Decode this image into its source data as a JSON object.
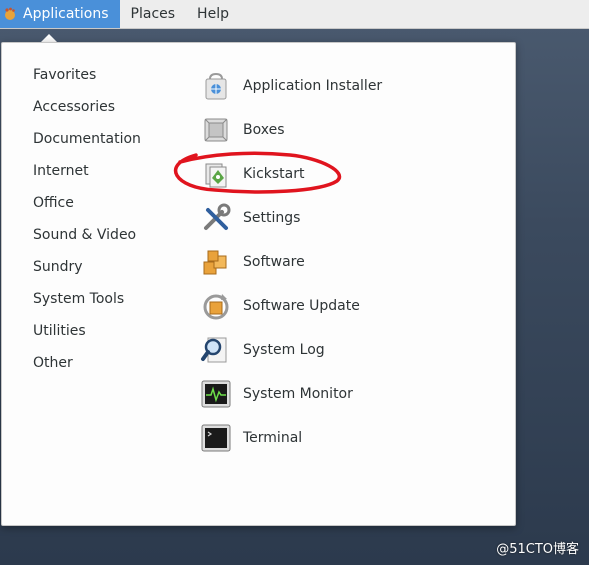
{
  "topbar": {
    "items": [
      {
        "label": "Applications",
        "active": true
      },
      {
        "label": "Places",
        "active": false
      },
      {
        "label": "Help",
        "active": false
      }
    ]
  },
  "categories": [
    "Favorites",
    "Accessories",
    "Documentation",
    "Internet",
    "Office",
    "Sound & Video",
    "Sundry",
    "System Tools",
    "Utilities",
    "Other"
  ],
  "apps": [
    {
      "label": "Application Installer",
      "icon": "bag-icon"
    },
    {
      "label": "Boxes",
      "icon": "boxes-icon"
    },
    {
      "label": "Kickstart",
      "icon": "kickstart-icon"
    },
    {
      "label": "Settings",
      "icon": "settings-icon"
    },
    {
      "label": "Software",
      "icon": "software-icon"
    },
    {
      "label": "Software Update",
      "icon": "software-update-icon"
    },
    {
      "label": "System Log",
      "icon": "system-log-icon"
    },
    {
      "label": "System Monitor",
      "icon": "system-monitor-icon"
    },
    {
      "label": "Terminal",
      "icon": "terminal-icon"
    }
  ],
  "watermark": "@51CTO博客",
  "colors": {
    "accent": "#4a90d9",
    "annotation": "#e0141e"
  }
}
